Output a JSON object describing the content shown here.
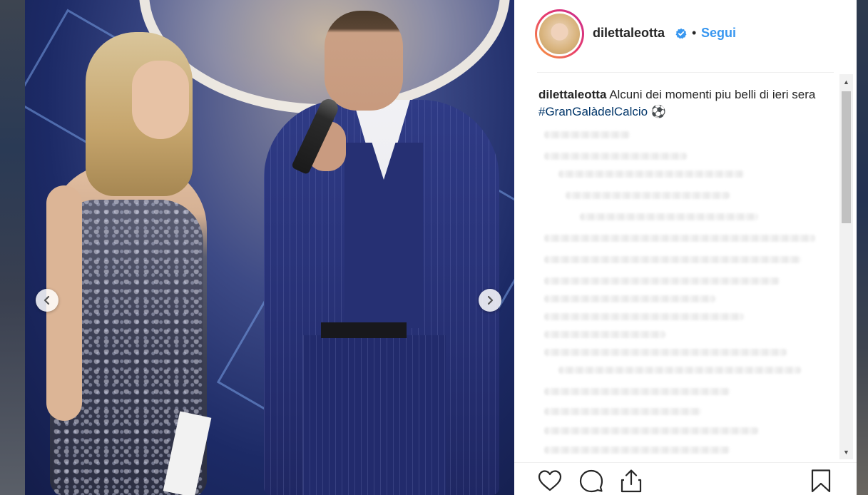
{
  "post": {
    "username": "dilettaleotta",
    "separator": "•",
    "follow_label": "Segui",
    "caption_user": "dilettaleotta",
    "caption_text": " Alcuni dei momenti piu belli di ieri sera ",
    "caption_hashtag": "#GranGalàdelCalcio",
    "caption_emoji": "⚽"
  },
  "media": {
    "prev_label": "‹",
    "next_label": "›"
  },
  "scrollbar": {
    "up": "▲",
    "down": "▼"
  },
  "icons": {
    "verified": "verified-badge-icon",
    "like": "heart-icon",
    "comment": "comment-icon",
    "share": "share-icon",
    "save": "bookmark-icon"
  },
  "colors": {
    "link_blue": "#3897f0",
    "hashtag": "#003569",
    "text": "#262626",
    "avatar_ring_start": "#f9a33b",
    "avatar_ring_end": "#c82a8f"
  }
}
